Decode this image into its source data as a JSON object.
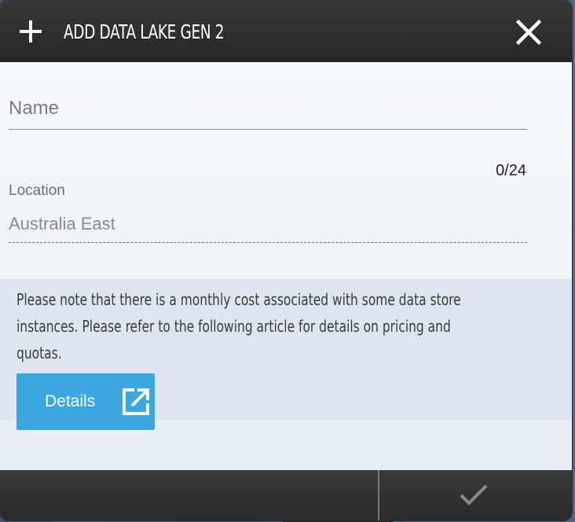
{
  "dialog": {
    "title": "ADD DATA LAKE GEN 2",
    "icons": {
      "add": "plus-icon",
      "close": "close-icon",
      "details": "external-link-icon",
      "confirm": "checkmark-icon"
    }
  },
  "form": {
    "name": {
      "placeholder": "Name",
      "value": "",
      "char_count": "0/24"
    },
    "location": {
      "label": "Location",
      "value": "Australia East"
    }
  },
  "notice": {
    "text": "Please note that there is a monthly cost associated with some data store instances. Please refer to the following article for details on pricing and quotas.",
    "line1": "Please note that there is a monthly cost associated with some data store",
    "line2": "instances. Please refer to the following article for details on pricing and",
    "line3": "quotas.",
    "details_label": "Details"
  },
  "colors": {
    "header_bg": "#2f2f2f",
    "accent": "#3aa7e0",
    "footer_bg": "#303030"
  }
}
